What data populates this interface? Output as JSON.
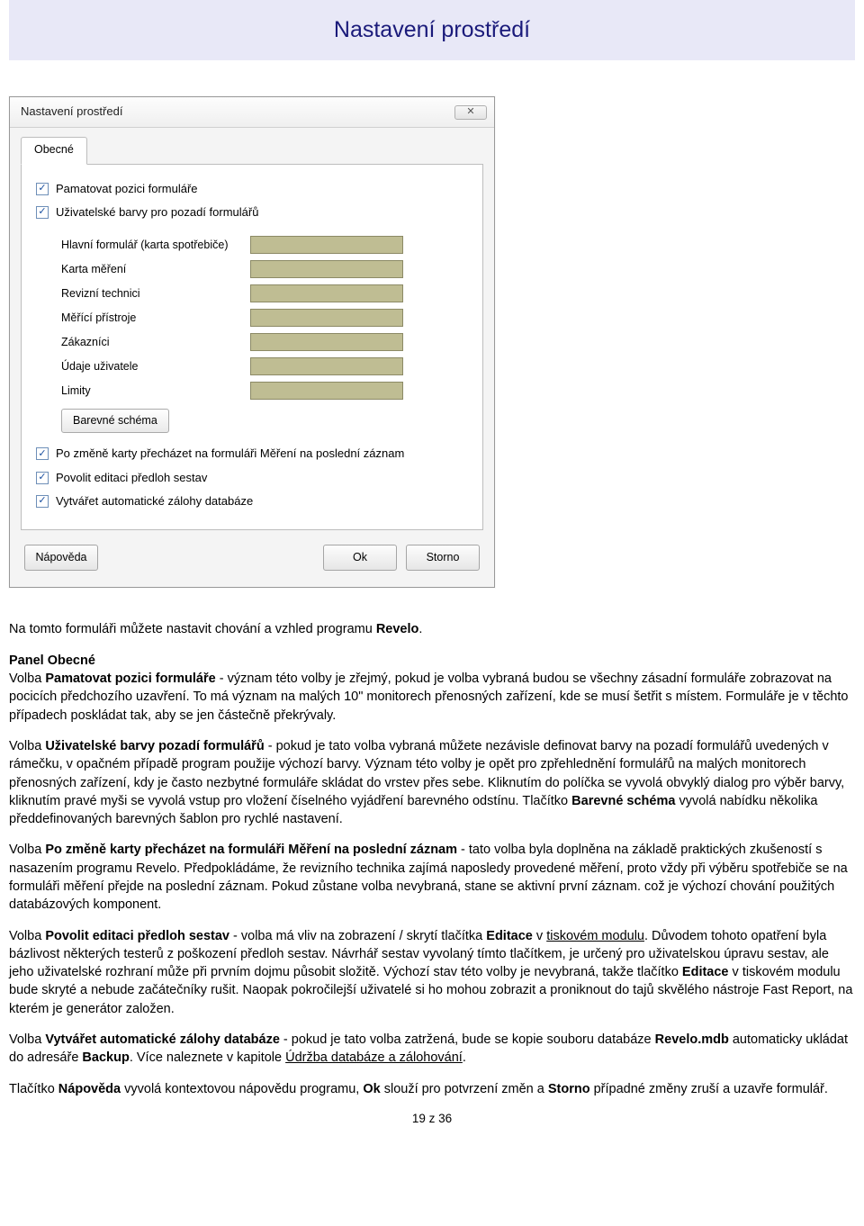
{
  "page_title": "Nastavení prostředí",
  "dialog": {
    "title": "Nastavení prostředí",
    "tab_label": "Obecné",
    "chk_remember_pos": "Pamatovat pozici formuláře",
    "chk_user_colors": "Uživatelské barvy pro pozadí formulářů",
    "color_rows": [
      "Hlavní formulář (karta spotřebiče)",
      "Karta měření",
      "Revizní technici",
      "Měřící přístroje",
      "Zákazníci",
      "Údaje uživatele",
      "Limity"
    ],
    "scheme_btn": "Barevné schéma",
    "chk_goto_last": "Po změně karty přecházet na formuláři Měření na poslední záznam",
    "chk_allow_edit": "Povolit editaci předloh sestav",
    "chk_auto_backup": "Vytvářet automatické zálohy databáze",
    "btn_help": "Nápověda",
    "btn_ok": "Ok",
    "btn_cancel": "Storno"
  },
  "doc": {
    "intro": "Na tomto formuláři můžete nastavit chování a vzhled programu ",
    "intro_bold": "Revelo",
    "intro_tail": ".",
    "p2_h": "Panel Obecné",
    "p2_a": "Volba ",
    "p2_b1": "Pamatovat pozici formuláře",
    "p2_c": " - význam této volby je zřejmý, pokud je volba vybraná budou se všechny zásadní formuláře zobrazovat na pocicích předchozího uzavření. To má význam na malých 10\" monitorech přenosných zařízení, kde se musí šetřit s místem. Formuláře je v těchto případech poskládat tak, aby se jen částečně překrývaly.",
    "p3_a": "Volba ",
    "p3_b1": "Uživatelské barvy pozadí formulářů",
    "p3_c": " - pokud je tato volba vybraná můžete nezávisle definovat barvy na pozadí formulářů uvedených v rámečku, v opačném případě program použije výchozí barvy. Význam této volby je opět pro zpřehlednění formulářů na malých monitorech přenosných zařízení, kdy je často nezbytné formuláře skládat do vrstev přes sebe. Kliknutím do políčka se vyvolá obvyklý dialog pro výběr barvy, kliknutím pravé myši se vyvolá vstup pro vložení číselného vyjádření barevného odstínu. Tlačítko ",
    "p3_b2": "Barevné schéma",
    "p3_d": " vyvolá nabídku několika předdefinovaných barevných šablon pro rychlé nastavení.",
    "p4_a": "Volba ",
    "p4_b1": "Po změně karty přecházet na formuláři Měření na poslední záznam",
    "p4_c": " - tato volba byla doplněna na základě praktických zkušeností s nasazením programu Revelo. Předpokládáme, že revizního technika zajímá naposledy provedené měření, proto vždy při výběru spotřebiče se na formuláři měření přejde na poslední záznam. Pokud zůstane volba nevybraná, stane se aktivní první záznam. což je výchozí chování použitých databázových komponent.",
    "p5_a": "Volba ",
    "p5_b1": "Povolit editaci předloh sestav",
    "p5_c": " - volba má vliv na zobrazení / skrytí tlačítka ",
    "p5_b2": "Editace",
    "p5_d": " v ",
    "p5_link": "tiskovém modulu",
    "p5_e": ". Důvodem tohoto opatření byla bázlivost některých testerů z poškození předloh sestav. Návrhář sestav vyvolaný tímto tlačítkem, je určený pro uživatelskou úpravu sestav, ale jeho uživatelské rozhraní může při prvním dojmu působit složitě. Výchozí stav této volby je nevybraná, takže tlačítko ",
    "p5_b3": "Editace",
    "p5_f": " v tiskovém modulu bude skryté a nebude začátečníky rušit. Naopak pokročilejší uživatelé si ho mohou zobrazit a proniknout do tajů skvělého nástroje Fast Report, na kterém je generátor založen.",
    "p6_a": "Volba ",
    "p6_b1": "Vytvářet automatické zálohy databáze",
    "p6_c": " - pokud je tato volba zatržená, bude se kopie souboru databáze ",
    "p6_b2": "Revelo.mdb",
    "p6_d": " automaticky ukládat do adresáře ",
    "p6_b3": "Backup",
    "p6_e": ". Více naleznete v kapitole ",
    "p6_link": "Údržba databáze a zálohování",
    "p6_f": ".",
    "p7_a": "Tlačítko ",
    "p7_b1": "Nápověda",
    "p7_c": " vyvolá kontextovou nápovědu programu, ",
    "p7_b2": "Ok",
    "p7_d": " slouží pro potvrzení změn a ",
    "p7_b3": "Storno",
    "p7_e": " případné změny zruší a uzavře formulář."
  },
  "footer": "19 z 36"
}
